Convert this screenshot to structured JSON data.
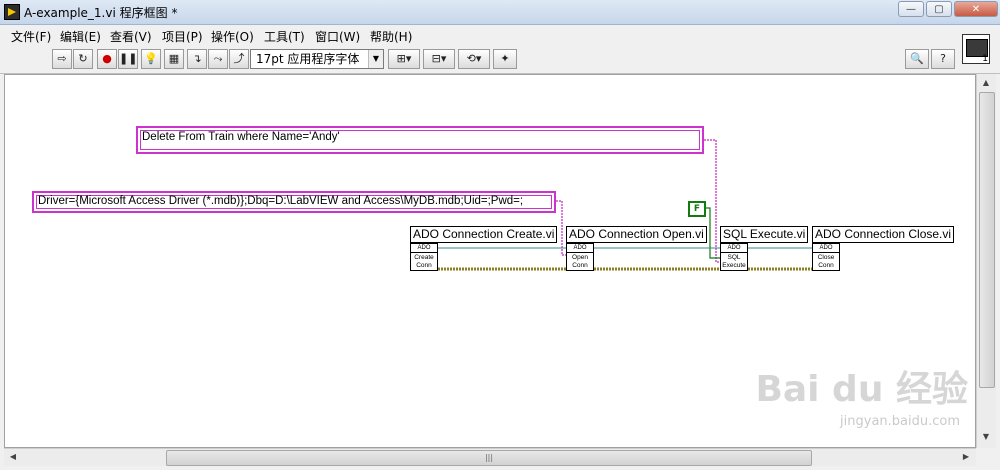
{
  "window": {
    "title": "A-example_1.vi 程序框图 *",
    "controls": [
      "—",
      "▢",
      "✕"
    ]
  },
  "menu": {
    "items": [
      "文件(F)",
      "编辑(E)",
      "查看(V)",
      "项目(P)",
      "操作(O)",
      "工具(T)",
      "窗口(W)",
      "帮助(H)"
    ]
  },
  "toolbar": {
    "font_select": "17pt 应用程序字体",
    "vi_icon_number": "1"
  },
  "diagram": {
    "sql_string": "Delete From Train where Name='Andy'",
    "connection_string": "Driver={Microsoft Access Driver (*.mdb)};Dbq=D:\\LabVIEW and Access\\MyDB.mdb;Uid=;Pwd=;",
    "bool_constant": "F",
    "subvis": [
      {
        "label": "ADO Connection Create.vi",
        "icon_header": "ADO",
        "icon_line1": "Create",
        "icon_line2": "Conn"
      },
      {
        "label": "ADO Connection Open.vi",
        "icon_header": "ADO",
        "icon_line1": "Open",
        "icon_line2": "Conn"
      },
      {
        "label": "SQL Execute.vi",
        "icon_header": "ADO",
        "icon_line1": "SQL",
        "icon_line2": "Execute"
      },
      {
        "label": "ADO Connection Close.vi",
        "icon_header": "ADO",
        "icon_line1": "Close",
        "icon_line2": "Conn"
      }
    ]
  },
  "watermark": {
    "main": "Bai du 经验",
    "sub": "jingyan.baidu.com"
  }
}
